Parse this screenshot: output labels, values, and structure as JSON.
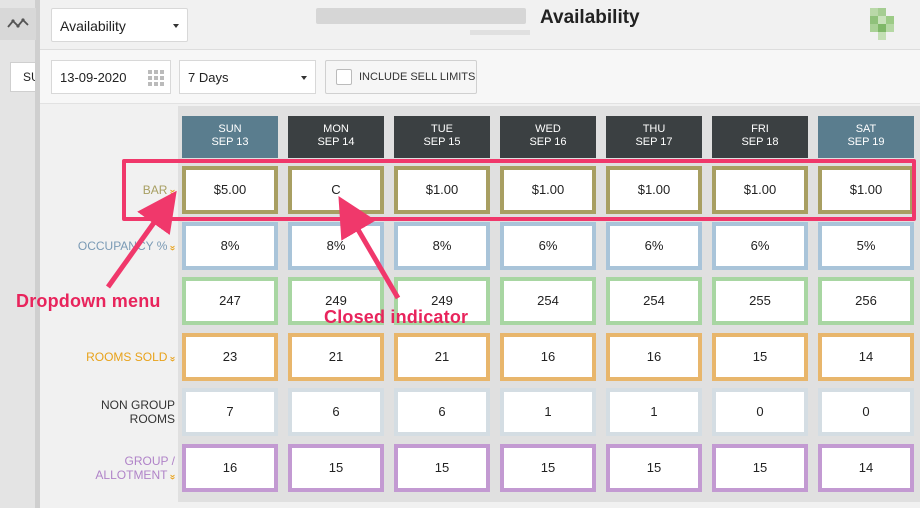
{
  "header": {
    "view_select": "Availability",
    "title": "Availability"
  },
  "rail": {
    "chip_text": "SU"
  },
  "toolbar": {
    "date": "13-09-2020",
    "days_select": "7 Days",
    "sell_limits_label": "INCLUDE SELL LIMITS"
  },
  "days": [
    {
      "dow": "SUN",
      "date": "SEP 13"
    },
    {
      "dow": "MON",
      "date": "SEP 14"
    },
    {
      "dow": "TUE",
      "date": "SEP 15"
    },
    {
      "dow": "WED",
      "date": "SEP 16"
    },
    {
      "dow": "THU",
      "date": "SEP 17"
    },
    {
      "dow": "FRI",
      "date": "SEP 18"
    },
    {
      "dow": "SAT",
      "date": "SEP 19"
    }
  ],
  "rows": [
    {
      "label": "BAR",
      "color": "#a89f62",
      "label_color": "#a89f62",
      "has_menu": true,
      "values": [
        "$5.00",
        "C",
        "$1.00",
        "$1.00",
        "$1.00",
        "$1.00",
        "$1.00"
      ]
    },
    {
      "label": "OCCUPANCY %",
      "color": "#a9c4d9",
      "label_color": "#7a9ab5",
      "has_menu": true,
      "values": [
        "8%",
        "8%",
        "8%",
        "6%",
        "6%",
        "6%",
        "5%"
      ]
    },
    {
      "label": "",
      "color": "#a8d6a2",
      "label_color": "#6aa866",
      "has_menu": false,
      "values": [
        "247",
        "249",
        "249",
        "254",
        "254",
        "255",
        "256"
      ]
    },
    {
      "label": "ROOMS SOLD",
      "color": "#e8b66c",
      "label_color": "#e8a21a",
      "has_menu": true,
      "values": [
        "23",
        "21",
        "21",
        "16",
        "16",
        "15",
        "14"
      ]
    },
    {
      "label": "NON GROUP ROOMS",
      "color": "#d4dde3",
      "label_color": "#333333",
      "has_menu": false,
      "values": [
        "7",
        "6",
        "6",
        "1",
        "1",
        "0",
        "0"
      ]
    },
    {
      "label": "GROUP / ALLOTMENT",
      "color": "#c39ad2",
      "label_color": "#b083c8",
      "has_menu": true,
      "values": [
        "16",
        "15",
        "15",
        "15",
        "15",
        "15",
        "14"
      ]
    }
  ],
  "annotations": {
    "dropdown_menu": "Dropdown menu",
    "closed_indicator": "Closed indicator",
    "color": "#f0386b"
  },
  "colors": {
    "weekday_header": "#3b4042",
    "weekend_header": "#5a7d8e",
    "chevron": "#e8a21a"
  }
}
